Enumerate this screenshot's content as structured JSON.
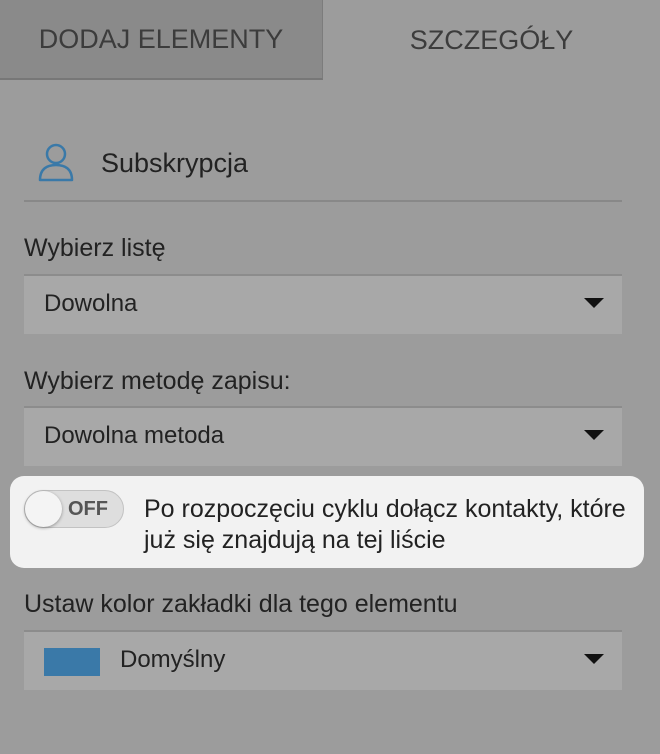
{
  "tabs": [
    {
      "label": "DODAJ ELEMENTY",
      "active": false
    },
    {
      "label": "SZCZEGÓŁY",
      "active": true
    }
  ],
  "section": {
    "title": "Subskrypcja",
    "icon": "user-icon"
  },
  "list_select": {
    "label": "Wybierz listę",
    "value": "Dowolna"
  },
  "method_select": {
    "label": "Wybierz metodę zapisu:",
    "value": "Dowolna metoda"
  },
  "toggle": {
    "state_label": "OFF",
    "on": false,
    "description": "Po rozpoczęciu cyklu dołącz kontakty, które już się znajdują na tej liście"
  },
  "color_select": {
    "label": "Ustaw kolor zakładki dla tego elementu",
    "value": "Domyślny",
    "swatch_color": "#3a79a8"
  },
  "colors": {
    "background": "#9c9c9c",
    "inactive_tab": "#8a8a8a",
    "highlight": "#f2f2f2",
    "icon_accent": "#3a79a8"
  }
}
